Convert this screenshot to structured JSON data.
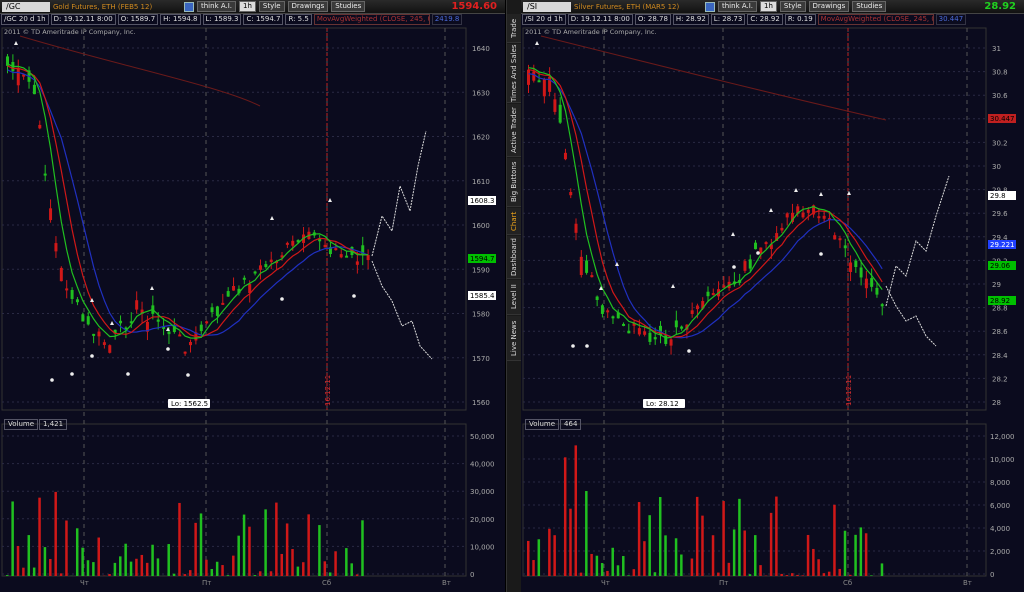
{
  "left": {
    "symbol": "/GC",
    "description": "Gold Futures, ETH (FEB5 12)",
    "think_label": "think A.I.",
    "timeframe": "1h",
    "style_btn": "Style",
    "drawings_btn": "Drawings",
    "studies_btn": "Studies",
    "last_price": "1594.60",
    "info": {
      "agg": "/GC 20 d 1h",
      "date": "D: 19.12.11 8:00",
      "open": "O: 1589.7",
      "high": "H: 1594.8",
      "low": "L: 1589.3",
      "close": "C: 1594.7",
      "range": "R: 5.5",
      "study": "MovAvgWeighted (CLOSE, 245, 0)",
      "extra": "2419.8"
    },
    "copyright": "2011 © TD Ameritrade IP Company, Inc.",
    "lo_label": "Lo: 1562.5",
    "date_marker": "16.12.11",
    "price_ticks": [
      "1640",
      "1630",
      "1620",
      "1610",
      "1600",
      "1590",
      "1580",
      "1570",
      "1560"
    ],
    "tags": [
      {
        "text": "1608.3",
        "color": "#ffffff",
        "bg": "#ffffff",
        "fg": "#000"
      },
      {
        "text": "1594.7",
        "color": "#00c000",
        "bg": "#00c000",
        "fg": "#000"
      },
      {
        "text": "1585.4",
        "color": "#ffffff",
        "bg": "#ffffff",
        "fg": "#000"
      }
    ],
    "volume_label": "Volume",
    "volume_value": "1,421",
    "volume_ticks": [
      "50,000",
      "40,000",
      "30,000",
      "20,000",
      "10,000",
      "0"
    ],
    "x_labels": [
      "Чт",
      "Пт",
      "Сб",
      "Вт"
    ]
  },
  "right": {
    "symbol": "/SI",
    "description": "Silver Futures, ETH (MAR5 12)",
    "think_label": "think A.I.",
    "timeframe": "1h",
    "style_btn": "Style",
    "drawings_btn": "Drawings",
    "studies_btn": "Studies",
    "last_price": "28.92",
    "info": {
      "agg": "/SI 20 d 1h",
      "date": "D: 19.12.11 8:00",
      "open": "O: 28.78",
      "high": "H: 28.92",
      "low": "L: 28.73",
      "close": "C: 28.92",
      "range": "R: 0.19",
      "study": "MovAvgWeighted (CLOSE, 245, 0)",
      "extra": "30.447"
    },
    "copyright": "2011 © TD Ameritrade IP Company, Inc.",
    "lo_label": "Lo: 28.12",
    "date_marker": "16.12.11",
    "price_ticks": [
      "31",
      "30.8",
      "30.6",
      "30.4",
      "30.2",
      "30",
      "29.8",
      "29.6",
      "29.4",
      "29.2",
      "29",
      "28.8",
      "28.6",
      "28.4",
      "28.2",
      "28"
    ],
    "tags": [
      {
        "text": "30.447",
        "color": "#c02020",
        "bg": "#c02020",
        "fg": "#000"
      },
      {
        "text": "29.8",
        "color": "#ffffff",
        "bg": "#ffffff",
        "fg": "#000"
      },
      {
        "text": "29.221",
        "color": "#2040ff",
        "bg": "#2040ff",
        "fg": "#fff"
      },
      {
        "text": "29.06",
        "color": "#00c000",
        "bg": "#00c000",
        "fg": "#000"
      },
      {
        "text": "28.92",
        "color": "#00c000",
        "bg": "#00c000",
        "fg": "#000"
      }
    ],
    "volume_label": "Volume",
    "volume_value": "464",
    "volume_ticks": [
      "12,000",
      "10,000",
      "8,000",
      "6,000",
      "4,000",
      "2,000",
      "0"
    ],
    "x_labels": [
      "Чт",
      "Пт",
      "Сб",
      "Вт"
    ]
  },
  "sidebar_tabs": [
    "Trade",
    "Times And Sales",
    "Active Trader",
    "Big Buttons",
    "Chart",
    "Dashboard",
    "Level II",
    "Live News"
  ],
  "active_tab": "Chart",
  "colors": {
    "up": "#20c020",
    "down": "#d01818",
    "ema_fast": "#20c020",
    "ema_mid": "#d01818",
    "ema_slow": "#2030c0",
    "background": "#0b0b1e",
    "grid": "#2a2a44"
  }
}
